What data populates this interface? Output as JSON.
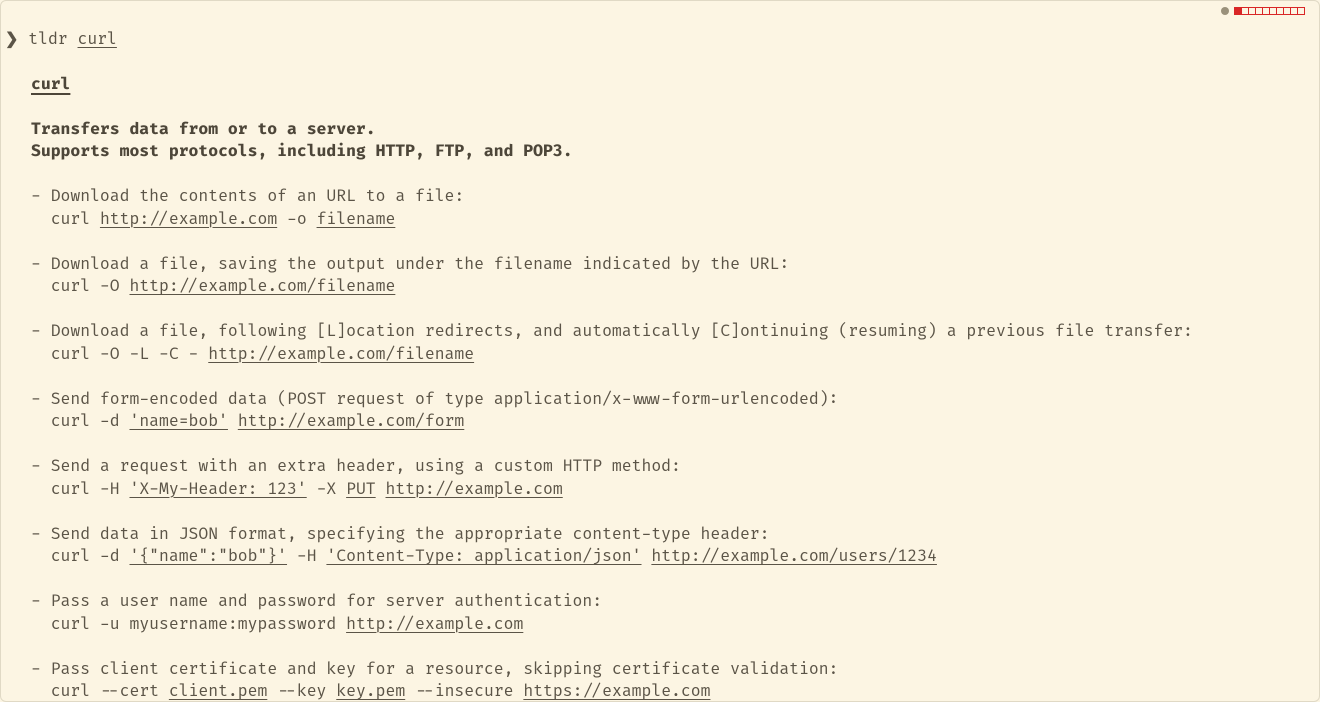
{
  "prompt": {
    "chevron": "❯",
    "cmd": "tldr",
    "arg": "curl"
  },
  "status": {
    "filled": 1,
    "empty": 9
  },
  "title": "curl",
  "desc1": "Transfers data from or to a server.",
  "desc2": "Supports most protocols, including HTTP, FTP, and POP3.",
  "e": [
    {
      "t": "Download the contents of an URL to a file:",
      "p": [
        "curl ",
        [
          "http://example.com"
        ],
        " -o ",
        [
          "filename"
        ]
      ]
    },
    {
      "t": "Download a file, saving the output under the filename indicated by the URL:",
      "p": [
        "curl -O ",
        [
          "http://example.com/filename"
        ]
      ]
    },
    {
      "t": "Download a file, following [L]ocation redirects, and automatically [C]ontinuing (resuming) a previous file transfer:",
      "p": [
        "curl -O -L -C - ",
        [
          "http://example.com/filename"
        ]
      ]
    },
    {
      "t": "Send form-encoded data (POST request of type application/x-www-form-urlencoded):",
      "p": [
        "curl -d ",
        [
          "'name=bob'"
        ],
        " ",
        [
          "http://example.com/form"
        ]
      ]
    },
    {
      "t": "Send a request with an extra header, using a custom HTTP method:",
      "p": [
        "curl -H ",
        [
          "'X-My-Header: 123'"
        ],
        " -X ",
        [
          "PUT"
        ],
        " ",
        [
          "http://example.com"
        ]
      ]
    },
    {
      "t": "Send data in JSON format, specifying the appropriate content-type header:",
      "p": [
        "curl -d ",
        [
          "'{\"name\":\"bob\"}'"
        ],
        " -H ",
        [
          "'Content-Type: application/json'"
        ],
        " ",
        [
          "http://example.com/users/1234"
        ]
      ]
    },
    {
      "t": "Pass a user name and password for server authentication:",
      "p": [
        "curl -u myusername:mypassword ",
        [
          "http://example.com"
        ]
      ]
    },
    {
      "t": "Pass client certificate and key for a resource, skipping certificate validation:",
      "p": [
        "curl --cert ",
        [
          "client.pem"
        ],
        " --key ",
        [
          "key.pem"
        ],
        " --insecure ",
        [
          "https://example.com"
        ]
      ]
    }
  ]
}
